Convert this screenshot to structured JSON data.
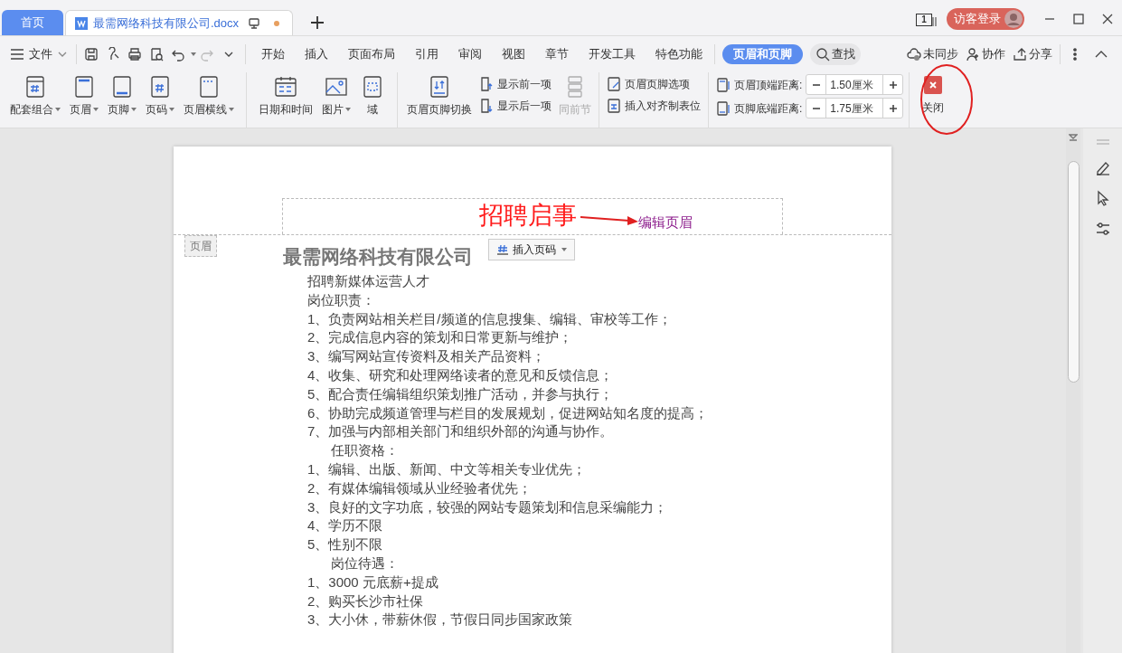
{
  "tabs": [
    {
      "label": "首页",
      "kind": "home",
      "selected": false
    },
    {
      "label": "最需网络科技有限公司.docx",
      "kind": "document",
      "selected": true,
      "modified": true
    }
  ],
  "title_bar": {
    "page_count": "1",
    "login": "访客登录"
  },
  "menu": {
    "file": "文件",
    "ribbon_tabs": [
      {
        "label": "开始",
        "selected": false
      },
      {
        "label": "插入",
        "selected": false
      },
      {
        "label": "页面布局",
        "selected": false
      },
      {
        "label": "引用",
        "selected": false
      },
      {
        "label": "审阅",
        "selected": false
      },
      {
        "label": "视图",
        "selected": false
      },
      {
        "label": "章节",
        "selected": false
      },
      {
        "label": "开发工具",
        "selected": false
      },
      {
        "label": "特色功能",
        "selected": false
      },
      {
        "label": "页眉和页脚",
        "selected": true
      }
    ],
    "search": "查找",
    "actions": [
      {
        "label": "未同步",
        "kind": "cloud"
      },
      {
        "label": "协作",
        "kind": "person"
      },
      {
        "label": "分享",
        "kind": "share"
      }
    ]
  },
  "ribbon": {
    "large_buttons_1": [
      {
        "label": "配套组合",
        "kind": "combo",
        "dropdown": true
      },
      {
        "label": "页眉",
        "kind": "header",
        "dropdown": true
      },
      {
        "label": "页脚",
        "kind": "footer",
        "dropdown": true
      },
      {
        "label": "页码",
        "kind": "number",
        "dropdown": true
      },
      {
        "label": "页眉横线",
        "kind": "line",
        "dropdown": true
      }
    ],
    "large_buttons_2": [
      {
        "label": "日期和时间",
        "kind": "calendar",
        "dropdown": false
      },
      {
        "label": "图片",
        "kind": "image",
        "dropdown": true
      },
      {
        "label": "域",
        "kind": "field",
        "dropdown": false
      }
    ],
    "switch_button": "页眉页脚切换",
    "nav_buttons": [
      {
        "label": "显示前一项",
        "kind": "up"
      },
      {
        "label": "显示后一项",
        "kind": "down"
      }
    ],
    "same_as_previous": {
      "label": "同前节",
      "disabled": true
    },
    "option_buttons": [
      {
        "label": "页眉页脚选项",
        "kind": "options"
      },
      {
        "label": "插入对齐制表位",
        "kind": "tab"
      }
    ],
    "spinners": [
      {
        "label": "页眉顶端距离:",
        "value": "1.50厘米",
        "kind": "top"
      },
      {
        "label": "页脚底端距离:",
        "value": "1.75厘米",
        "kind": "bottom"
      }
    ],
    "close": "关闭"
  },
  "document": {
    "header_text": "招聘启事",
    "annotation": "编辑页眉",
    "header_tag": "页眉",
    "insert_page_number": "插入页码",
    "title": "最需网络科技有限公司",
    "lines": [
      {
        "text": "招聘新媒体运营人才",
        "indent": false
      },
      {
        "text": "岗位职责：",
        "indent": false
      },
      {
        "text": "1、负责网站相关栏目/频道的信息搜集、编辑、审校等工作；",
        "indent": false
      },
      {
        "text": "2、完成信息内容的策划和日常更新与维护；",
        "indent": false
      },
      {
        "text": "3、编写网站宣传资料及相关产品资料；",
        "indent": false
      },
      {
        "text": "4、收集、研究和处理网络读者的意见和反馈信息；",
        "indent": false
      },
      {
        "text": "5、配合责任编辑组织策划推广活动，并参与执行；",
        "indent": false
      },
      {
        "text": "6、协助完成频道管理与栏目的发展规划，促进网站知名度的提高；",
        "indent": false
      },
      {
        "text": "7、加强与内部相关部门和组织外部的沟通与协作。",
        "indent": false
      },
      {
        "text": "任职资格：",
        "indent": true
      },
      {
        "text": "1、编辑、出版、新闻、中文等相关专业优先；",
        "indent": false
      },
      {
        "text": "2、有媒体编辑领域从业经验者优先；",
        "indent": false
      },
      {
        "text": "3、良好的文字功底，较强的网站专题策划和信息采编能力；",
        "indent": false
      },
      {
        "text": "4、学历不限",
        "indent": false
      },
      {
        "text": "5、性别不限",
        "indent": false
      },
      {
        "text": "岗位待遇：",
        "indent": true
      },
      {
        "text": "1、3000 元底薪+提成",
        "indent": false
      },
      {
        "text": "2、购买长沙市社保",
        "indent": false
      },
      {
        "text": "3、大小休，带薪休假，节假日同步国家政策",
        "indent": false
      }
    ]
  }
}
